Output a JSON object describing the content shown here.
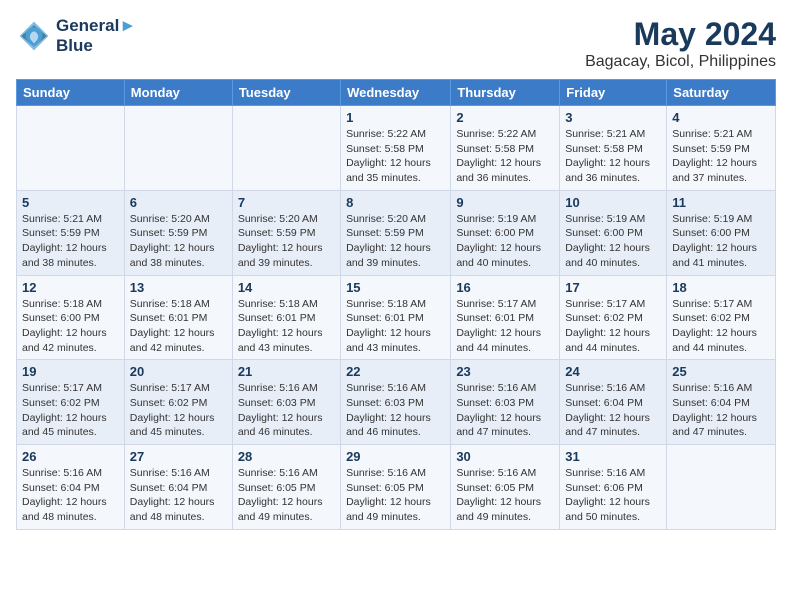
{
  "logo": {
    "line1": "General",
    "line2": "Blue"
  },
  "title": "May 2024",
  "subtitle": "Bagacay, Bicol, Philippines",
  "days_of_week": [
    "Sunday",
    "Monday",
    "Tuesday",
    "Wednesday",
    "Thursday",
    "Friday",
    "Saturday"
  ],
  "weeks": [
    [
      {
        "day": "",
        "sunrise": "",
        "sunset": "",
        "daylight": ""
      },
      {
        "day": "",
        "sunrise": "",
        "sunset": "",
        "daylight": ""
      },
      {
        "day": "",
        "sunrise": "",
        "sunset": "",
        "daylight": ""
      },
      {
        "day": "1",
        "sunrise": "Sunrise: 5:22 AM",
        "sunset": "Sunset: 5:58 PM",
        "daylight": "Daylight: 12 hours and 35 minutes."
      },
      {
        "day": "2",
        "sunrise": "Sunrise: 5:22 AM",
        "sunset": "Sunset: 5:58 PM",
        "daylight": "Daylight: 12 hours and 36 minutes."
      },
      {
        "day": "3",
        "sunrise": "Sunrise: 5:21 AM",
        "sunset": "Sunset: 5:58 PM",
        "daylight": "Daylight: 12 hours and 36 minutes."
      },
      {
        "day": "4",
        "sunrise": "Sunrise: 5:21 AM",
        "sunset": "Sunset: 5:59 PM",
        "daylight": "Daylight: 12 hours and 37 minutes."
      }
    ],
    [
      {
        "day": "5",
        "sunrise": "Sunrise: 5:21 AM",
        "sunset": "Sunset: 5:59 PM",
        "daylight": "Daylight: 12 hours and 38 minutes."
      },
      {
        "day": "6",
        "sunrise": "Sunrise: 5:20 AM",
        "sunset": "Sunset: 5:59 PM",
        "daylight": "Daylight: 12 hours and 38 minutes."
      },
      {
        "day": "7",
        "sunrise": "Sunrise: 5:20 AM",
        "sunset": "Sunset: 5:59 PM",
        "daylight": "Daylight: 12 hours and 39 minutes."
      },
      {
        "day": "8",
        "sunrise": "Sunrise: 5:20 AM",
        "sunset": "Sunset: 5:59 PM",
        "daylight": "Daylight: 12 hours and 39 minutes."
      },
      {
        "day": "9",
        "sunrise": "Sunrise: 5:19 AM",
        "sunset": "Sunset: 6:00 PM",
        "daylight": "Daylight: 12 hours and 40 minutes."
      },
      {
        "day": "10",
        "sunrise": "Sunrise: 5:19 AM",
        "sunset": "Sunset: 6:00 PM",
        "daylight": "Daylight: 12 hours and 40 minutes."
      },
      {
        "day": "11",
        "sunrise": "Sunrise: 5:19 AM",
        "sunset": "Sunset: 6:00 PM",
        "daylight": "Daylight: 12 hours and 41 minutes."
      }
    ],
    [
      {
        "day": "12",
        "sunrise": "Sunrise: 5:18 AM",
        "sunset": "Sunset: 6:00 PM",
        "daylight": "Daylight: 12 hours and 42 minutes."
      },
      {
        "day": "13",
        "sunrise": "Sunrise: 5:18 AM",
        "sunset": "Sunset: 6:01 PM",
        "daylight": "Daylight: 12 hours and 42 minutes."
      },
      {
        "day": "14",
        "sunrise": "Sunrise: 5:18 AM",
        "sunset": "Sunset: 6:01 PM",
        "daylight": "Daylight: 12 hours and 43 minutes."
      },
      {
        "day": "15",
        "sunrise": "Sunrise: 5:18 AM",
        "sunset": "Sunset: 6:01 PM",
        "daylight": "Daylight: 12 hours and 43 minutes."
      },
      {
        "day": "16",
        "sunrise": "Sunrise: 5:17 AM",
        "sunset": "Sunset: 6:01 PM",
        "daylight": "Daylight: 12 hours and 44 minutes."
      },
      {
        "day": "17",
        "sunrise": "Sunrise: 5:17 AM",
        "sunset": "Sunset: 6:02 PM",
        "daylight": "Daylight: 12 hours and 44 minutes."
      },
      {
        "day": "18",
        "sunrise": "Sunrise: 5:17 AM",
        "sunset": "Sunset: 6:02 PM",
        "daylight": "Daylight: 12 hours and 44 minutes."
      }
    ],
    [
      {
        "day": "19",
        "sunrise": "Sunrise: 5:17 AM",
        "sunset": "Sunset: 6:02 PM",
        "daylight": "Daylight: 12 hours and 45 minutes."
      },
      {
        "day": "20",
        "sunrise": "Sunrise: 5:17 AM",
        "sunset": "Sunset: 6:02 PM",
        "daylight": "Daylight: 12 hours and 45 minutes."
      },
      {
        "day": "21",
        "sunrise": "Sunrise: 5:16 AM",
        "sunset": "Sunset: 6:03 PM",
        "daylight": "Daylight: 12 hours and 46 minutes."
      },
      {
        "day": "22",
        "sunrise": "Sunrise: 5:16 AM",
        "sunset": "Sunset: 6:03 PM",
        "daylight": "Daylight: 12 hours and 46 minutes."
      },
      {
        "day": "23",
        "sunrise": "Sunrise: 5:16 AM",
        "sunset": "Sunset: 6:03 PM",
        "daylight": "Daylight: 12 hours and 47 minutes."
      },
      {
        "day": "24",
        "sunrise": "Sunrise: 5:16 AM",
        "sunset": "Sunset: 6:04 PM",
        "daylight": "Daylight: 12 hours and 47 minutes."
      },
      {
        "day": "25",
        "sunrise": "Sunrise: 5:16 AM",
        "sunset": "Sunset: 6:04 PM",
        "daylight": "Daylight: 12 hours and 47 minutes."
      }
    ],
    [
      {
        "day": "26",
        "sunrise": "Sunrise: 5:16 AM",
        "sunset": "Sunset: 6:04 PM",
        "daylight": "Daylight: 12 hours and 48 minutes."
      },
      {
        "day": "27",
        "sunrise": "Sunrise: 5:16 AM",
        "sunset": "Sunset: 6:04 PM",
        "daylight": "Daylight: 12 hours and 48 minutes."
      },
      {
        "day": "28",
        "sunrise": "Sunrise: 5:16 AM",
        "sunset": "Sunset: 6:05 PM",
        "daylight": "Daylight: 12 hours and 49 minutes."
      },
      {
        "day": "29",
        "sunrise": "Sunrise: 5:16 AM",
        "sunset": "Sunset: 6:05 PM",
        "daylight": "Daylight: 12 hours and 49 minutes."
      },
      {
        "day": "30",
        "sunrise": "Sunrise: 5:16 AM",
        "sunset": "Sunset: 6:05 PM",
        "daylight": "Daylight: 12 hours and 49 minutes."
      },
      {
        "day": "31",
        "sunrise": "Sunrise: 5:16 AM",
        "sunset": "Sunset: 6:06 PM",
        "daylight": "Daylight: 12 hours and 50 minutes."
      },
      {
        "day": "",
        "sunrise": "",
        "sunset": "",
        "daylight": ""
      }
    ]
  ]
}
